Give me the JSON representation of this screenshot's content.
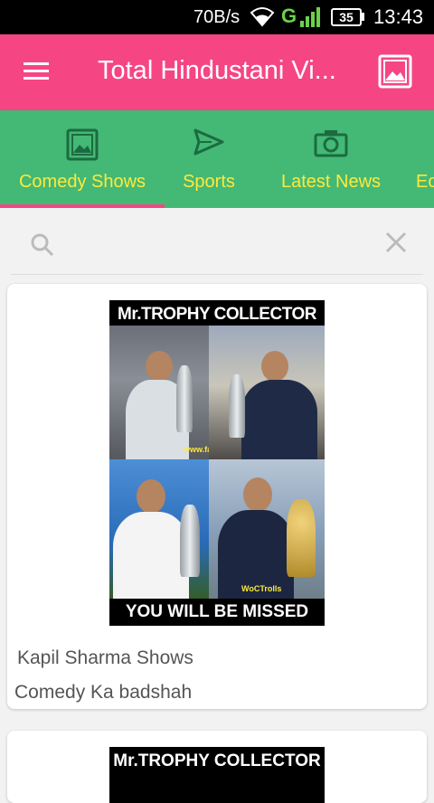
{
  "status_bar": {
    "net_speed": "70B/s",
    "network_type": "G",
    "battery": "35",
    "time": "13:43"
  },
  "app_bar": {
    "title": "Total Hindustani Vi...",
    "menu_icon": "hamburger-menu-icon",
    "image_icon": "image-icon"
  },
  "tabs": [
    {
      "label": "Comedy Shows",
      "icon": "image-icon",
      "selected": true
    },
    {
      "label": "Sports",
      "icon": "send-icon",
      "selected": false
    },
    {
      "label": "Latest News",
      "icon": "camera-icon",
      "selected": false
    },
    {
      "label": "Ec",
      "icon": "",
      "selected": false
    }
  ],
  "search": {
    "placeholder": "",
    "value": ""
  },
  "cards": [
    {
      "image_top_text": "Mr.TROPHY COLLECTOR",
      "image_bottom_text": "YOU WILL BE MISSED",
      "watermark": "www.facebook.com/WoCTrolls",
      "watermark_short": "WoCTrolls",
      "title": "Kapil Sharma Shows",
      "subtitle": "Comedy Ka badshah"
    },
    {
      "image_top_text": "Mr.TROPHY COLLECTOR"
    }
  ],
  "colors": {
    "app_bar": "#f64583",
    "tab_bar": "#44b875",
    "tab_text": "#ffe93b",
    "indicator": "#f64583"
  }
}
